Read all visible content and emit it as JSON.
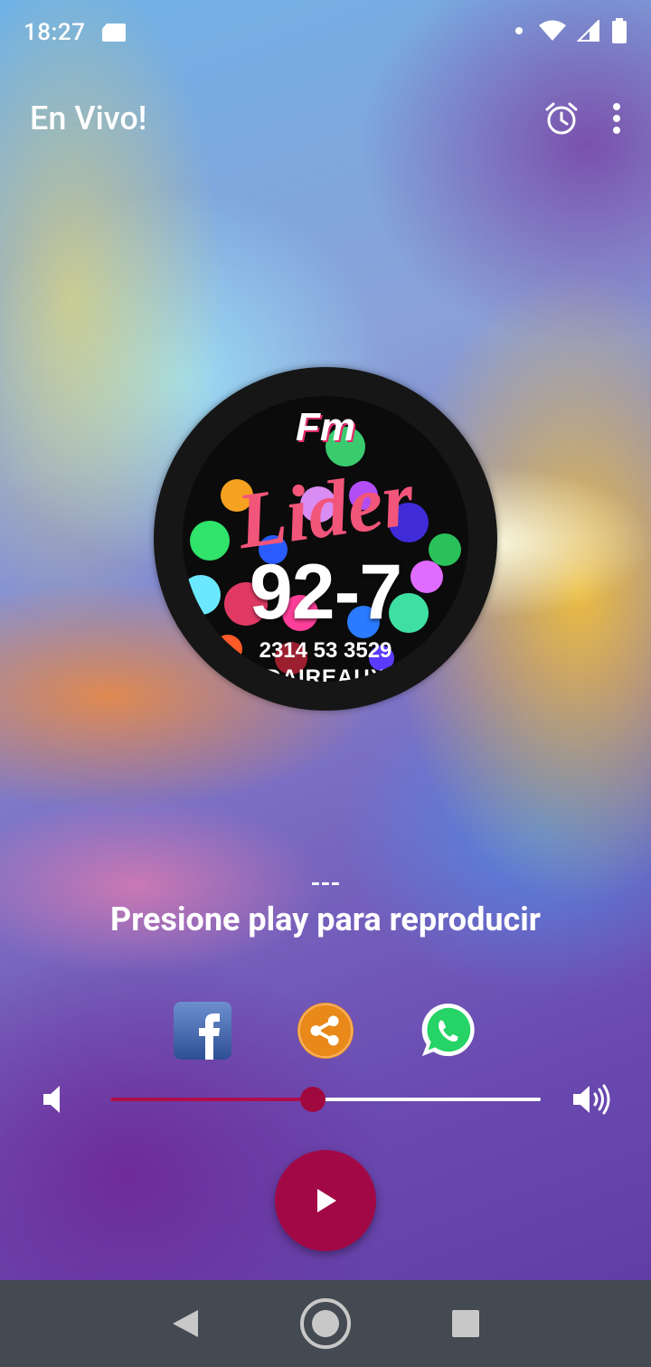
{
  "status_bar": {
    "time": "18:27",
    "icons": [
      "sd-card-icon",
      "notification-dot-icon",
      "wifi-icon",
      "signal-icon",
      "battery-icon"
    ]
  },
  "app_bar": {
    "title": "En Vivo!",
    "actions": [
      "alarm-clock-icon",
      "more-vert-icon"
    ]
  },
  "station_logo": {
    "fm": "Fm",
    "name": "Lider",
    "frequency": "92-7",
    "phone": "2314 53 3529",
    "city": "DAIREAUX"
  },
  "now_playing": {
    "dash": "---",
    "status": "Presione play para reproducir"
  },
  "social": {
    "items": [
      "facebook-icon",
      "share-icon",
      "whatsapp-icon"
    ]
  },
  "volume": {
    "level": 0.47,
    "accent": "#b00d4a"
  },
  "player": {
    "play_color": "#a30846",
    "icon": "play-icon"
  },
  "nav_bar": {
    "background": "#444a52",
    "items": [
      "back-icon",
      "home-icon",
      "recents-icon"
    ]
  }
}
